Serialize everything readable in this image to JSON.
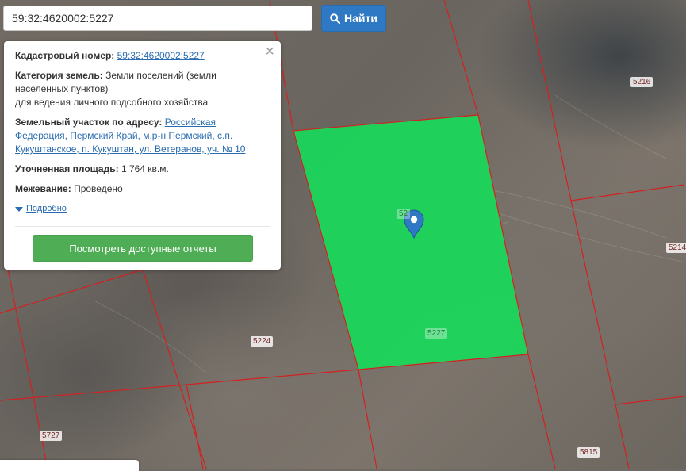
{
  "search": {
    "value": "59:32:4620002:5227",
    "button_label": "Найти",
    "button_icon": "search-icon"
  },
  "popup": {
    "cadastral_label": "Кадастровый номер:",
    "cadastral_value": "59:32:4620002:5227",
    "category_label": "Категория земель:",
    "category_value_1": "Земли поселений (земли",
    "category_value_2": "населенных пунктов)",
    "category_value_3": "для ведения личного подсобного хозяйства",
    "address_label": "Земельный участок по адресу:",
    "address_line_1": "Российская",
    "address_line_2": "Федерация, Пермский Край, м.р-н Пермский, с.п.",
    "address_line_3": "Кукуштанское, п. Кукуштан, ул. Ветеранов, уч. № 10",
    "area_label": "Уточненная площадь:",
    "area_value": "1 764 кв.м.",
    "survey_label": "Межевание:",
    "survey_value": "Проведено",
    "details_link": "Подробно",
    "report_button": "Посмотреть доступные отчеты",
    "close_symbol": "×"
  },
  "map": {
    "highlight_color": "#19d85a",
    "boundary_color": "#d42020",
    "plot_labels": [
      "5216",
      "5214",
      "5224",
      "5227",
      "5727",
      "5815",
      "52"
    ],
    "marker_icon": "map-pin-icon"
  }
}
